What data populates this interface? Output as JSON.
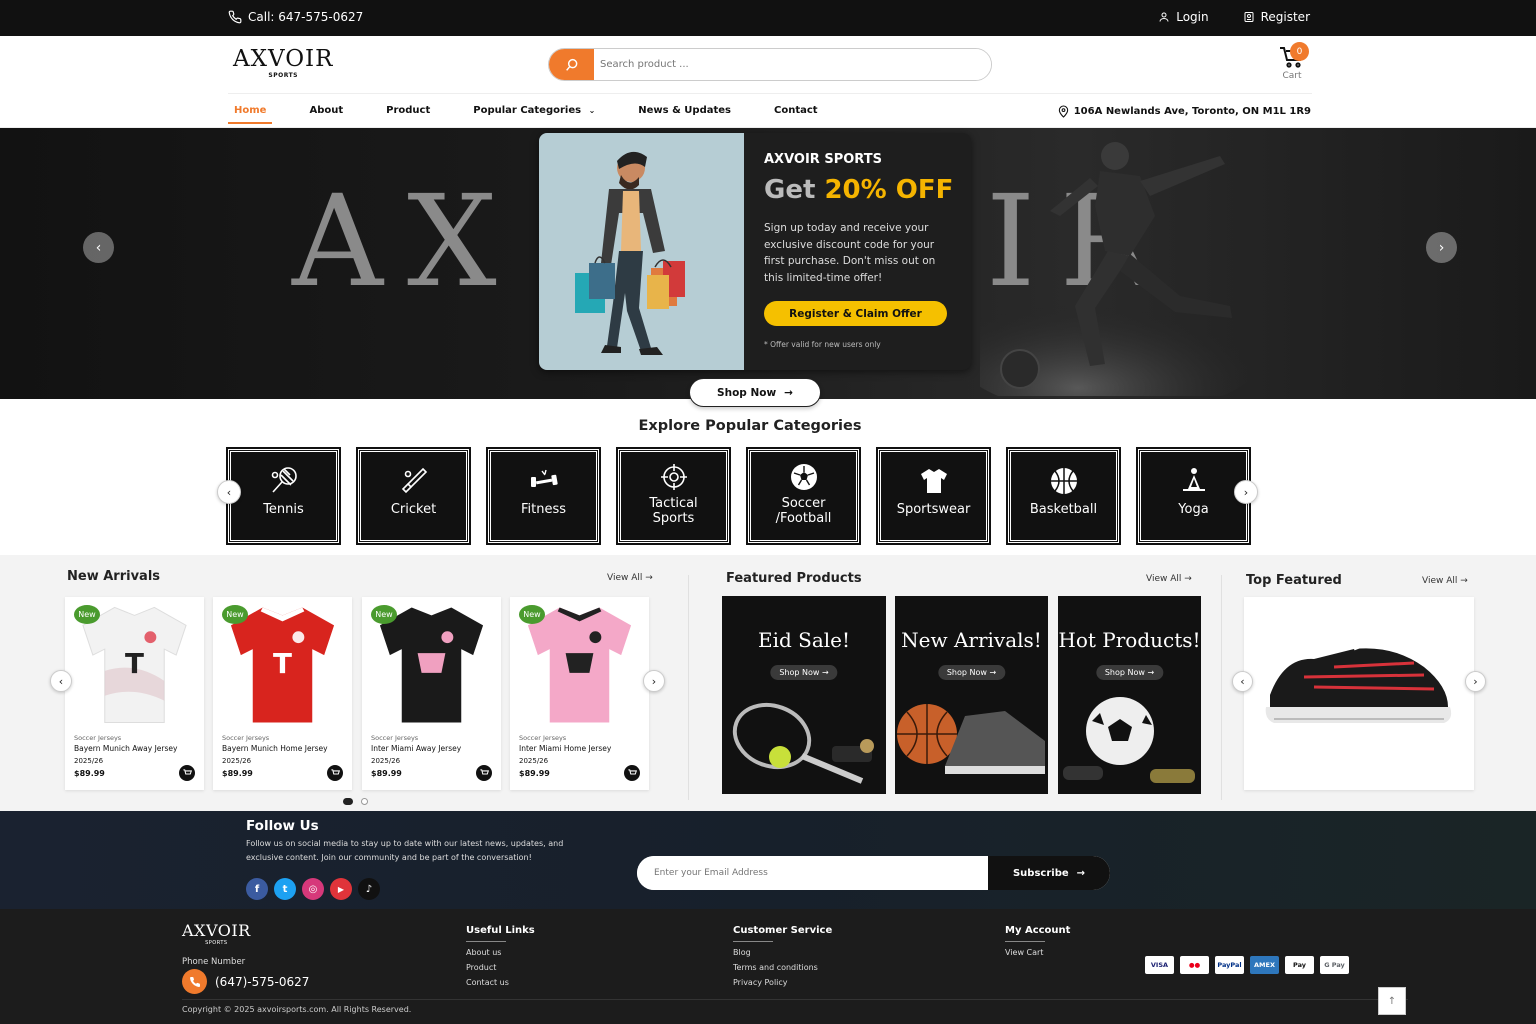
{
  "topbar": {
    "phone": "Call: 647-575-0627",
    "login": "Login",
    "register": "Register"
  },
  "header": {
    "logo": "AXVOIR",
    "logo_sub": "SPORTS",
    "search_placeholder": "Search product ...",
    "cart_count": "0",
    "cart_label": "Cart",
    "address": "106A Newlands Ave, Toronto, ON M1L 1R9"
  },
  "nav": [
    {
      "label": "Home"
    },
    {
      "label": "About"
    },
    {
      "label": "Product"
    },
    {
      "label": "Popular Categories"
    },
    {
      "label": "News & Updates"
    },
    {
      "label": "Contact"
    }
  ],
  "hero": {
    "big_text_left": "AX",
    "big_text_right": "IR",
    "popup": {
      "brand": "AXVOIR SPORTS",
      "offer_prefix": "Get ",
      "offer_highlight": "20% OFF",
      "description": "Sign up today and receive your exclusive discount code for your first purchase. Don't miss out on this limited-time offer!",
      "cta": "Register & Claim Offer",
      "note": "* Offer valid for new users only"
    },
    "shop_now": "Shop Now"
  },
  "categories": {
    "title": "Explore Popular Categories",
    "items": [
      {
        "name": "Tennis",
        "icon": "tennis-racket-icon"
      },
      {
        "name": "Cricket",
        "icon": "cricket-bat-icon"
      },
      {
        "name": "Fitness",
        "icon": "dumbbell-icon"
      },
      {
        "name": "Tactical Sports",
        "icon": "crosshair-icon"
      },
      {
        "name": "Soccer /Football",
        "icon": "soccer-ball-icon"
      },
      {
        "name": "Sportswear",
        "icon": "tshirt-icon"
      },
      {
        "name": "Basketball",
        "icon": "basketball-icon"
      },
      {
        "name": "Yoga",
        "icon": "yoga-icon"
      }
    ]
  },
  "new_arrivals": {
    "title": "New Arrivals",
    "view_all": "View All",
    "products": [
      {
        "badge": "New",
        "category": "Soccer Jerseys",
        "name": "Bayern Munich Away Jersey",
        "year": "2025/26",
        "price": "$89.99",
        "color": "#f2f2f2",
        "accent": "#c8a0a8"
      },
      {
        "badge": "New",
        "category": "Soccer Jerseys",
        "name": "Bayern Munich Home Jersey",
        "year": "2025/26",
        "price": "$89.99",
        "color": "#d8241e",
        "accent": "#ffffff"
      },
      {
        "badge": "New",
        "category": "Soccer Jerseys",
        "name": "Inter Miami Away Jersey",
        "year": "2025/26",
        "price": "$89.99",
        "color": "#1a1a1a",
        "accent": "#f0a0c0"
      },
      {
        "badge": "New",
        "category": "Soccer Jerseys",
        "name": "Inter Miami Home Jersey",
        "year": "2025/26",
        "price": "$89.99",
        "color": "#f4a8c8",
        "accent": "#222222"
      }
    ]
  },
  "featured": {
    "title": "Featured Products",
    "view_all": "View All",
    "banners": [
      {
        "title": "Eid Sale!",
        "button": "Shop Now"
      },
      {
        "title": "New Arrivals!",
        "button": "Shop Now"
      },
      {
        "title": "Hot Products!",
        "button": "Shop Now"
      }
    ]
  },
  "top_featured": {
    "title": "Top Featured",
    "view_all": "View All"
  },
  "follow": {
    "title": "Follow Us",
    "description": "Follow us on social media to stay up to date with our latest news, updates, and exclusive content. Join our community and be part of the conversation!",
    "email_placeholder": "Enter your Email Address",
    "subscribe": "Subscribe",
    "social": [
      {
        "icon": "facebook-icon",
        "glyph": "f",
        "color": "#3b5ba0"
      },
      {
        "icon": "twitter-icon",
        "glyph": "t",
        "color": "#1da1f2"
      },
      {
        "icon": "instagram-icon",
        "glyph": "◎",
        "color": "#d6387a"
      },
      {
        "icon": "youtube-icon",
        "glyph": "▶",
        "color": "#e0343a"
      },
      {
        "icon": "tiktok-icon",
        "glyph": "♪",
        "color": "#111111"
      }
    ]
  },
  "footer": {
    "logo": "AXVOIR",
    "logo_sub": "SPORTS",
    "phone_label": "Phone Number",
    "phone": "(647)-575-0627",
    "columns": [
      {
        "heading": "Useful Links",
        "links": [
          "About us",
          "Product",
          "Contact us"
        ]
      },
      {
        "heading": "Customer Service",
        "links": [
          "Blog",
          "Terms and conditions",
          "Privacy Policy"
        ]
      },
      {
        "heading": "My Account",
        "links": [
          "View Cart"
        ]
      }
    ],
    "payments": [
      {
        "label": "VISA",
        "color": "#1a1f71"
      },
      {
        "label": "●●",
        "color": "#eb001b"
      },
      {
        "label": "PayPal",
        "color": "#003087"
      },
      {
        "label": "AMEX",
        "color": "#2e77bc"
      },
      {
        "label": "Pay",
        "color": "#111111"
      },
      {
        "label": "G Pay",
        "color": "#5f6368"
      }
    ],
    "copyright": "Copyright © 2025 axvoirsports.com. All Rights Reserved."
  },
  "colors": {
    "accent": "#f07a2c",
    "cta_yellow": "#f5c000",
    "badge_green": "#4a9b2e"
  }
}
